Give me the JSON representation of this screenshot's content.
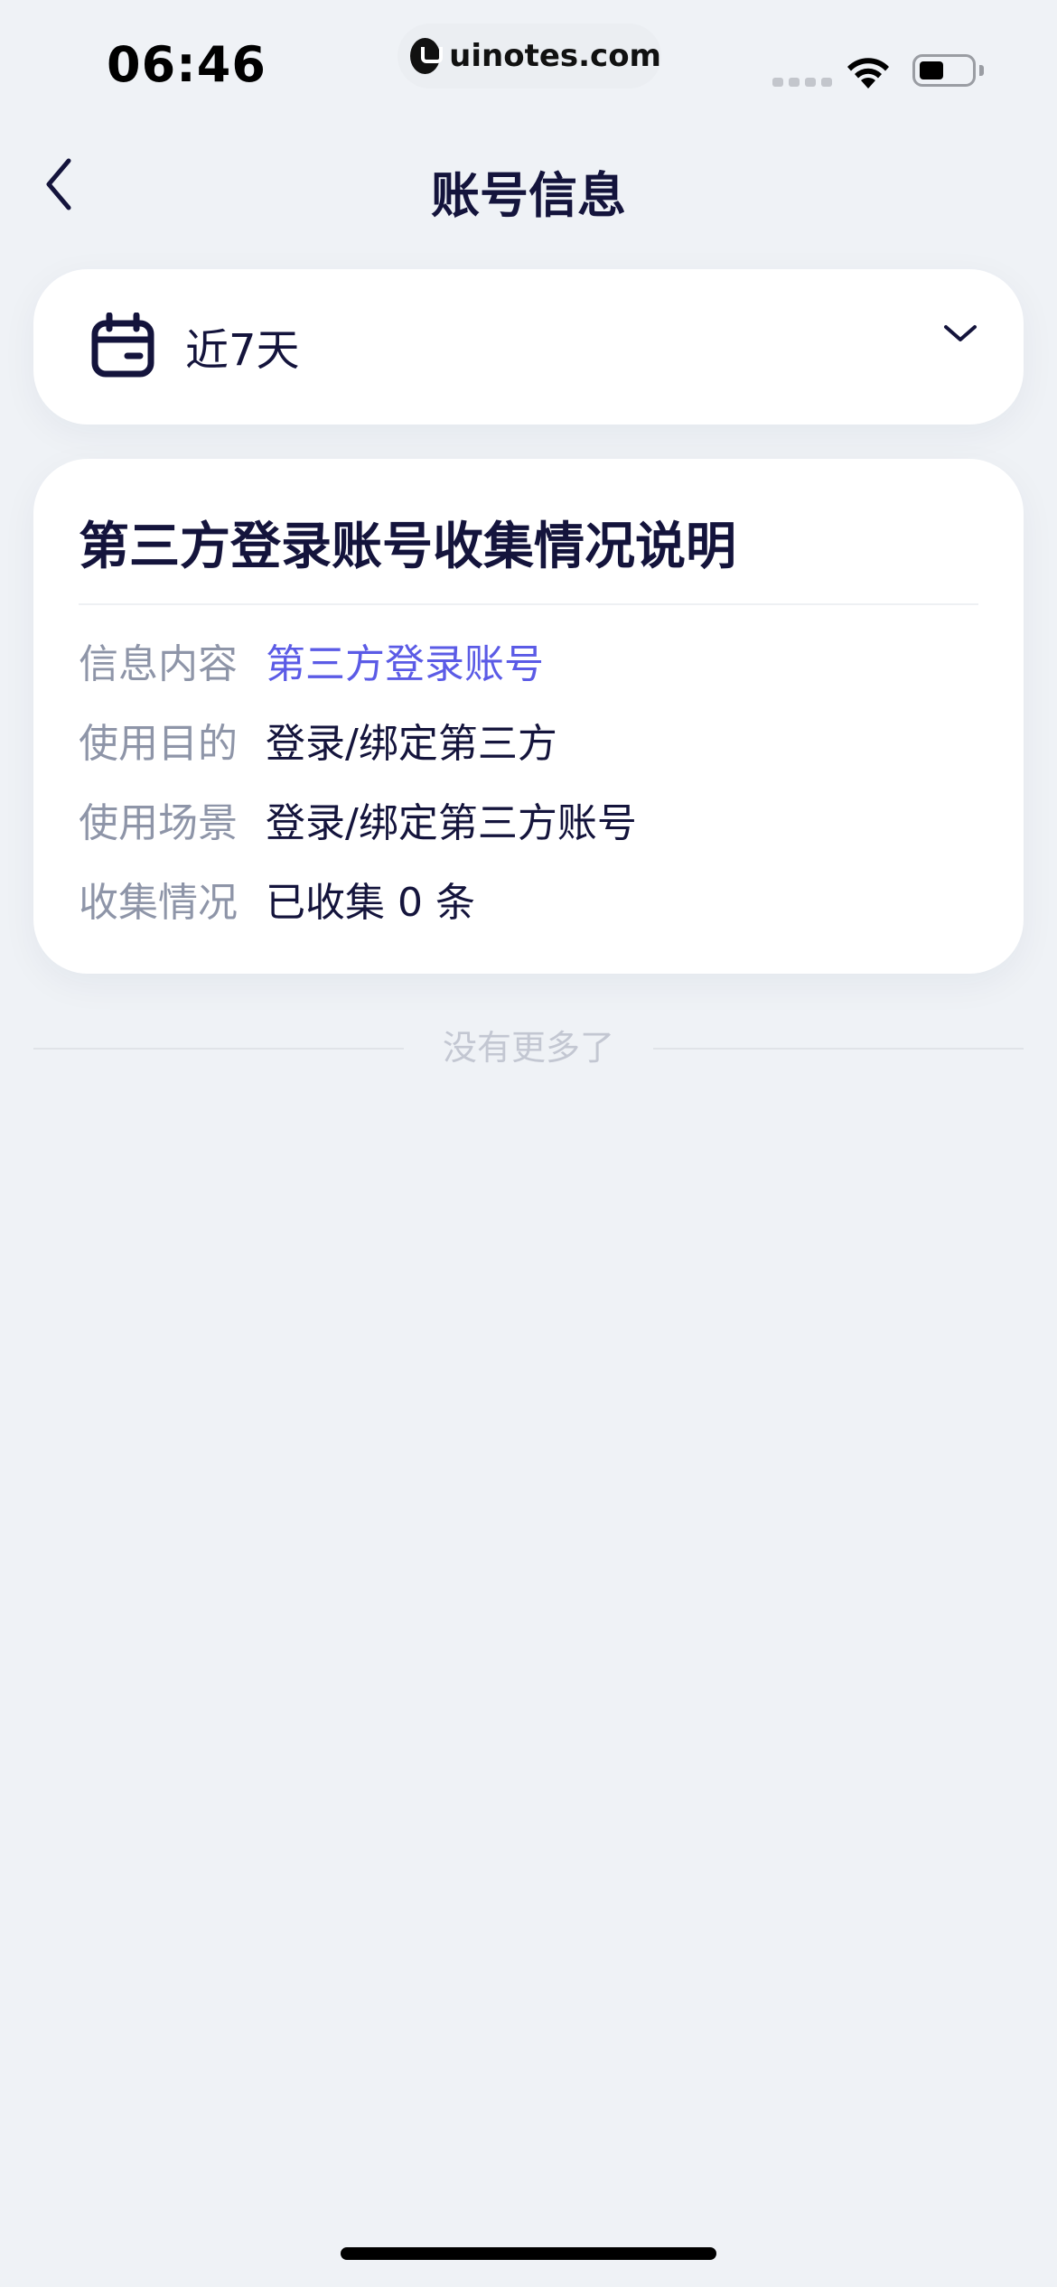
{
  "status_bar": {
    "time": "06:46",
    "url": "uinotes.com"
  },
  "nav": {
    "title": "账号信息",
    "back_icon": "chevron-left-icon"
  },
  "filter": {
    "icon": "calendar-icon",
    "label": "近7天",
    "dropdown_icon": "chevron-down-icon"
  },
  "card": {
    "title": "第三方登录账号收集情况说明",
    "rows": [
      {
        "key": "信息内容",
        "value": "第三方登录账号",
        "is_link": true
      },
      {
        "key": "使用目的",
        "value": "登录/绑定第三方",
        "is_link": false
      },
      {
        "key": "使用场景",
        "value": "登录/绑定第三方账号",
        "is_link": false
      },
      {
        "key": "收集情况",
        "value": "已收集 0 条",
        "is_link": false
      }
    ]
  },
  "footer": {
    "end_text": "没有更多了"
  },
  "colors": {
    "background": "#eff2f6",
    "primary_text": "#14143c",
    "secondary_text": "#8e95a8",
    "link": "#5b5be6",
    "muted": "#c3c7d2"
  }
}
